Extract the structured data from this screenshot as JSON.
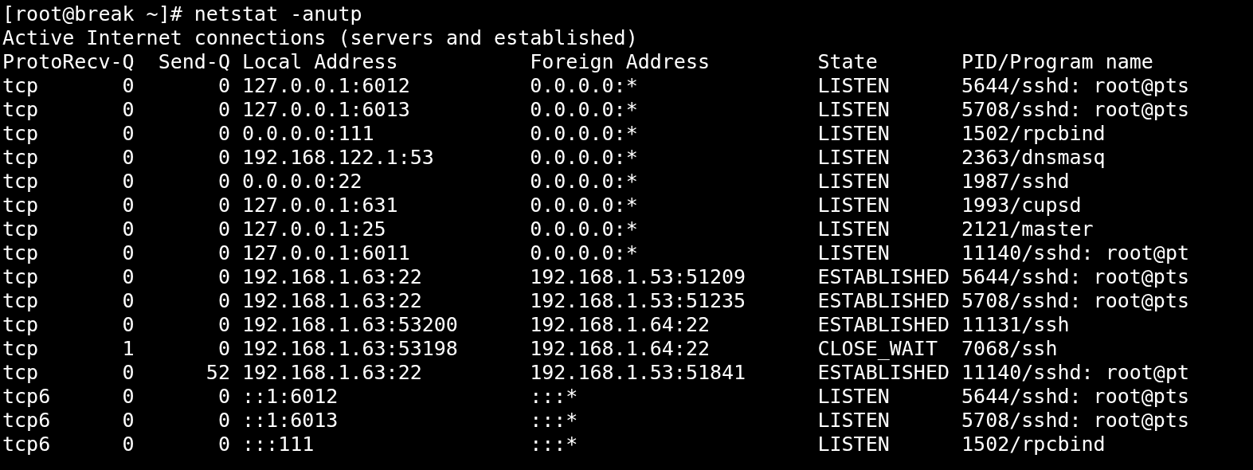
{
  "terminal": {
    "command_line": "[root@break ~]# netstat -anutp",
    "title_line": "Active Internet connections (servers and established)",
    "table": {
      "columns": [
        "Proto",
        "Recv-Q",
        "Send-Q",
        "Local Address",
        "Foreign Address",
        "State",
        "PID/Program name"
      ],
      "rows": [
        [
          "tcp",
          "0",
          "0",
          "127.0.0.1:6012",
          "0.0.0.0:*",
          "LISTEN",
          "5644/sshd: root@pts"
        ],
        [
          "tcp",
          "0",
          "0",
          "127.0.0.1:6013",
          "0.0.0.0:*",
          "LISTEN",
          "5708/sshd: root@pts"
        ],
        [
          "tcp",
          "0",
          "0",
          "0.0.0.0:111",
          "0.0.0.0:*",
          "LISTEN",
          "1502/rpcbind"
        ],
        [
          "tcp",
          "0",
          "0",
          "192.168.122.1:53",
          "0.0.0.0:*",
          "LISTEN",
          "2363/dnsmasq"
        ],
        [
          "tcp",
          "0",
          "0",
          "0.0.0.0:22",
          "0.0.0.0:*",
          "LISTEN",
          "1987/sshd"
        ],
        [
          "tcp",
          "0",
          "0",
          "127.0.0.1:631",
          "0.0.0.0:*",
          "LISTEN",
          "1993/cupsd"
        ],
        [
          "tcp",
          "0",
          "0",
          "127.0.0.1:25",
          "0.0.0.0:*",
          "LISTEN",
          "2121/master"
        ],
        [
          "tcp",
          "0",
          "0",
          "127.0.0.1:6011",
          "0.0.0.0:*",
          "LISTEN",
          "11140/sshd: root@pt"
        ],
        [
          "tcp",
          "0",
          "0",
          "192.168.1.63:22",
          "192.168.1.53:51209",
          "ESTABLISHED",
          "5644/sshd: root@pts"
        ],
        [
          "tcp",
          "0",
          "0",
          "192.168.1.63:22",
          "192.168.1.53:51235",
          "ESTABLISHED",
          "5708/sshd: root@pts"
        ],
        [
          "tcp",
          "0",
          "0",
          "192.168.1.63:53200",
          "192.168.1.64:22",
          "ESTABLISHED",
          "11131/ssh"
        ],
        [
          "tcp",
          "1",
          "0",
          "192.168.1.63:53198",
          "192.168.1.64:22",
          "CLOSE_WAIT",
          "7068/ssh"
        ],
        [
          "tcp",
          "0",
          "52",
          "192.168.1.63:22",
          "192.168.1.53:51841",
          "ESTABLISHED",
          "11140/sshd: root@pt"
        ],
        [
          "tcp6",
          "0",
          "0",
          "::1:6012",
          ":::*",
          "LISTEN",
          "5644/sshd: root@pts"
        ],
        [
          "tcp6",
          "0",
          "0",
          "::1:6013",
          ":::*",
          "LISTEN",
          "5708/sshd: root@pts"
        ],
        [
          "tcp6",
          "0",
          "0",
          ":::111",
          ":::*",
          "LISTEN",
          "1502/rpcbind"
        ]
      ]
    }
  }
}
